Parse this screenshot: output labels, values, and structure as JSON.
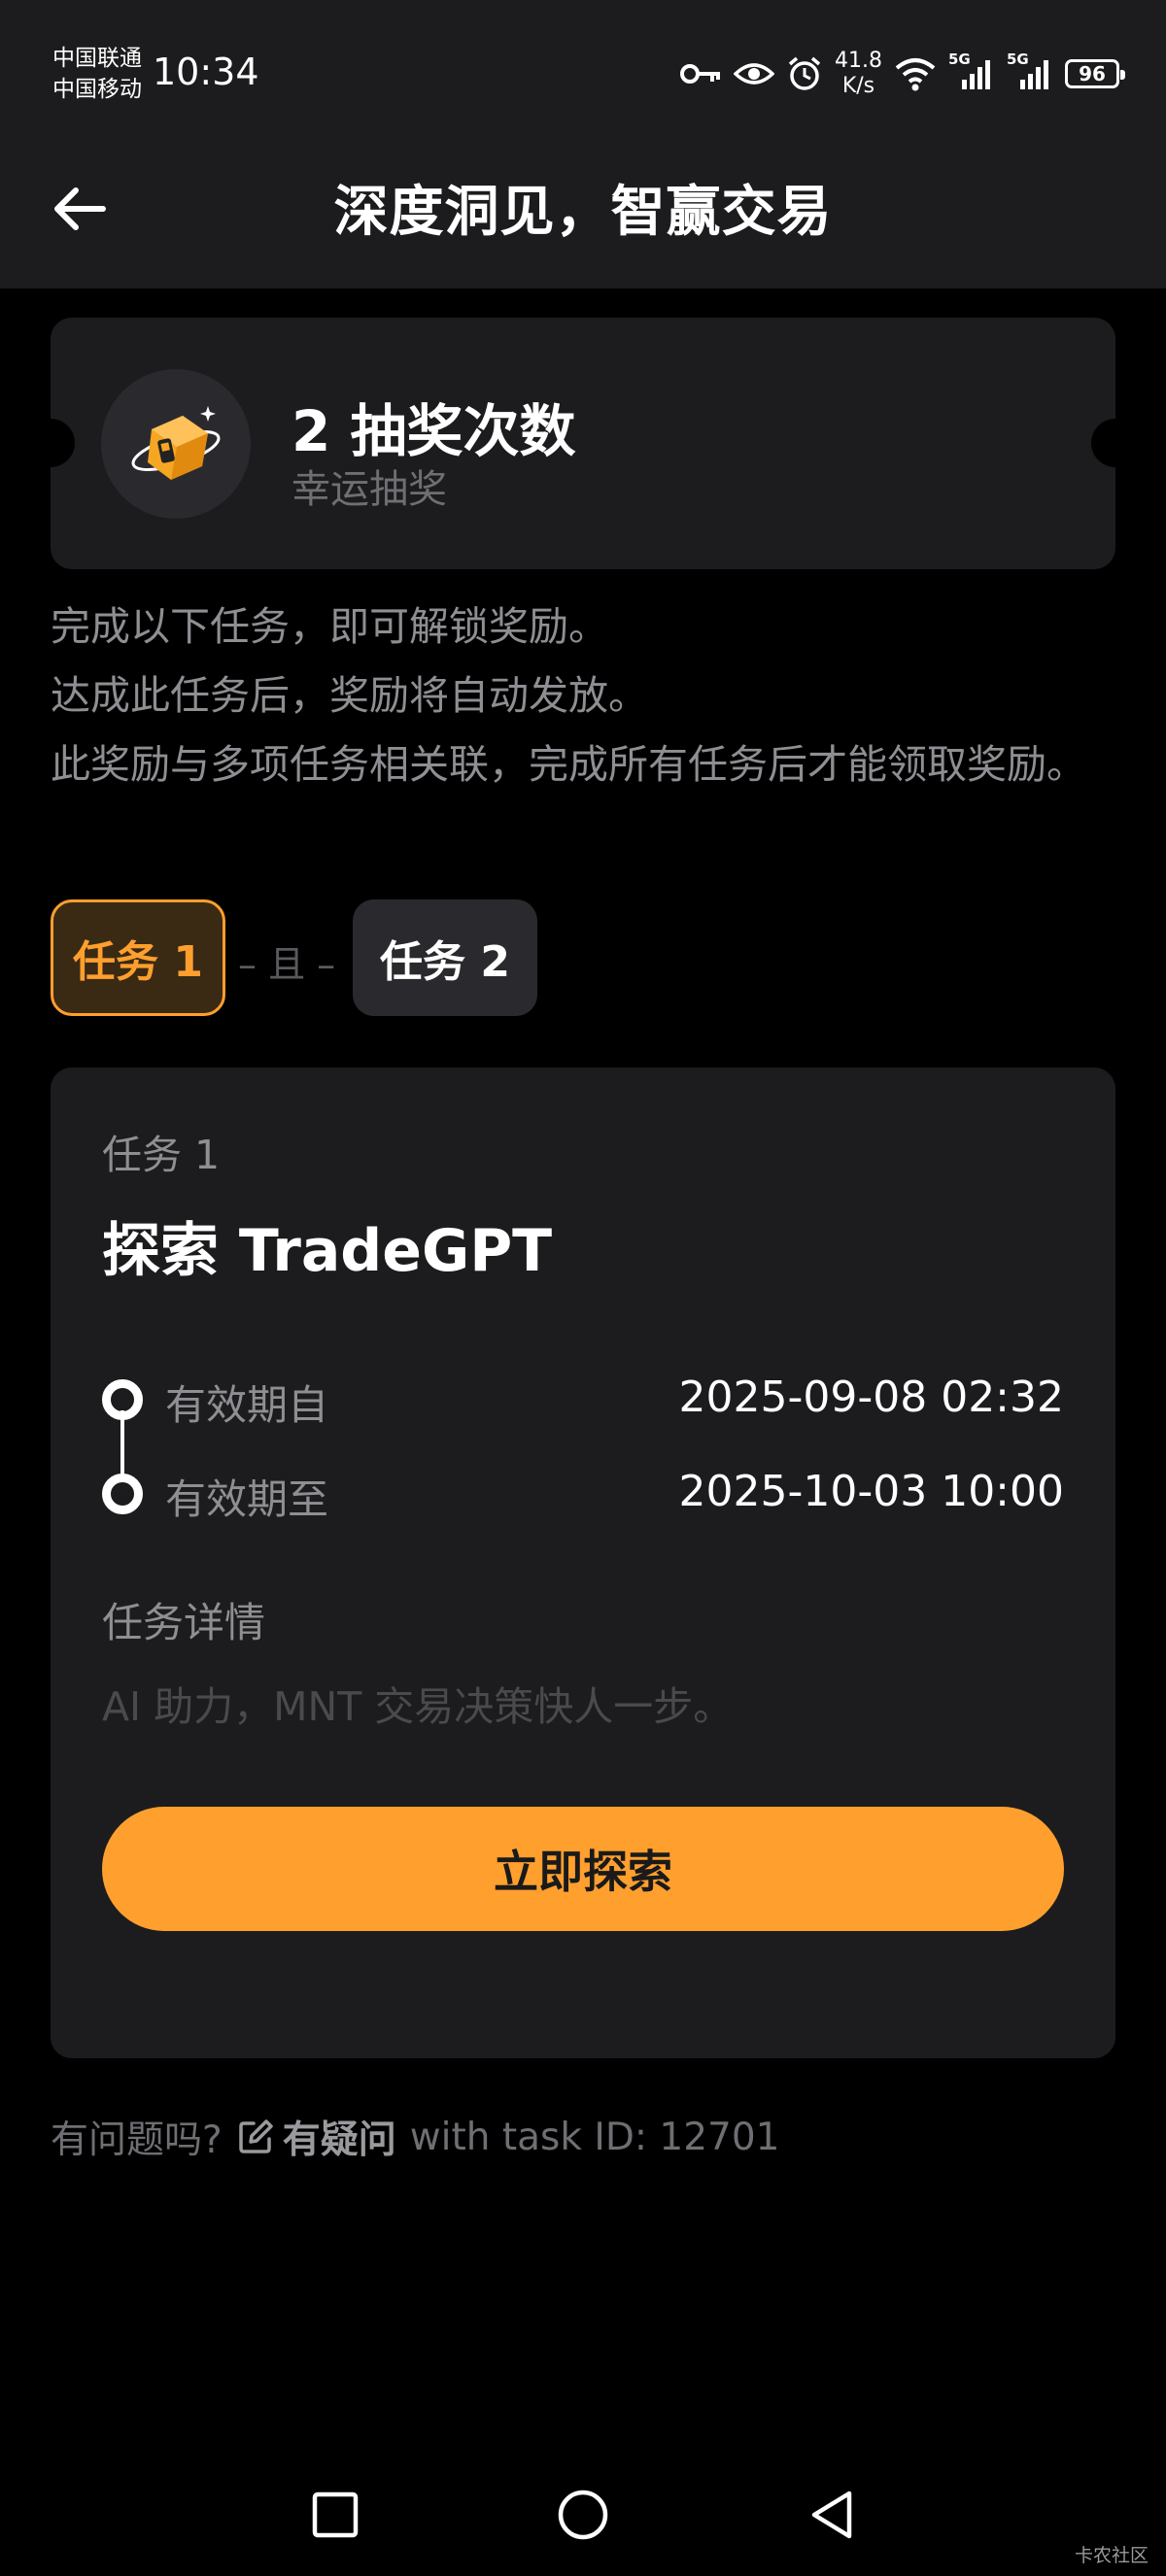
{
  "status_bar": {
    "carrier_1": "中国联通",
    "carrier_2": "中国移动",
    "time": "10:34",
    "net_speed_value": "41.8",
    "net_speed_unit": "K/s",
    "battery": "96",
    "signal_1_label": "5G",
    "signal_2_label": "5G",
    "icons": [
      "key-icon",
      "eye-icon",
      "alarm-icon",
      "wifi-icon",
      "signal-icon",
      "battery-icon"
    ]
  },
  "header": {
    "title": "深度洞见，智赢交易",
    "back_icon": "arrow-left-icon"
  },
  "reward": {
    "count_text": "2 抽奖次数",
    "subtitle": "幸运抽奖",
    "icon": "lucky-box-icon"
  },
  "description": {
    "line_1": "完成以下任务，即可解锁奖励。",
    "line_2": "达成此任务后，奖励将自动发放。",
    "line_3": "此奖励与多项任务相关联，完成所有任务后才能领取奖励。"
  },
  "tabs": {
    "task_1": "任务 1",
    "connector": "– 且 –",
    "task_2": "任务 2"
  },
  "task": {
    "label": "任务 1",
    "title": "探索 TradeGPT",
    "valid_from_label": "有效期自",
    "valid_from_value": "2025-09-08 02:32",
    "valid_to_label": "有效期至",
    "valid_to_value": "2025-10-03 10:00",
    "detail_title": "任务详情",
    "detail_text": "AI 助力，MNT 交易决策快人一步。",
    "button_label": "立即探索"
  },
  "help": {
    "question": "有问题吗?",
    "link_label": "有疑问",
    "task_id_text": "with task ID: 12701"
  },
  "nav": {
    "icons": [
      "square-recent-icon",
      "circle-home-icon",
      "triangle-back-icon"
    ],
    "watermark": "卡农社区"
  },
  "colors": {
    "accent": "#ff9f2e",
    "card_bg": "#1c1c1e",
    "muted_text": "#8e8e93"
  }
}
